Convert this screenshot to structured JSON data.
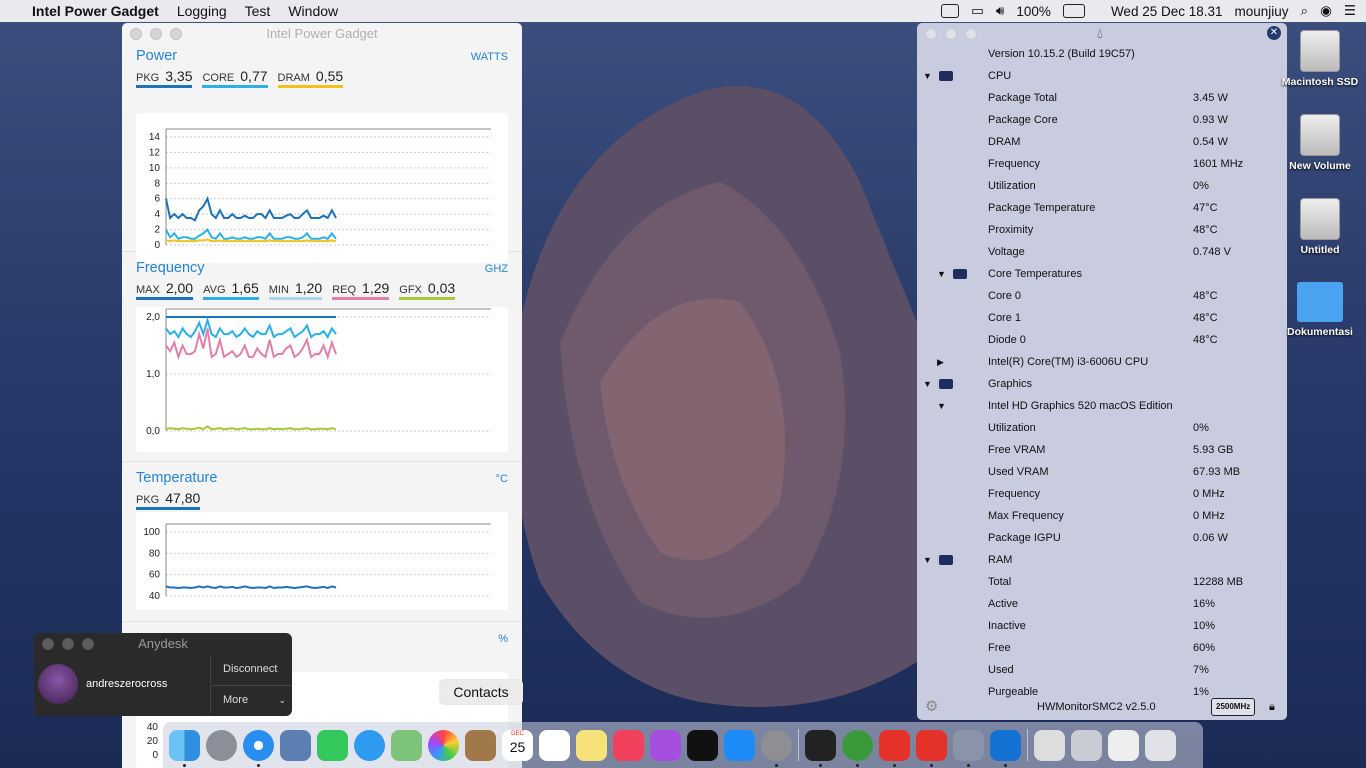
{
  "menubar": {
    "app": "Intel Power Gadget",
    "menus": [
      "Logging",
      "Test",
      "Window"
    ],
    "battery": "100%",
    "clock": "Wed 25 Dec  18.31",
    "user": "mounjiuy"
  },
  "ipg": {
    "title": "Intel Power Gadget",
    "power": {
      "label": "Power",
      "unit": "WATTS",
      "metrics": [
        {
          "k": "PKG",
          "v": "3,35",
          "color": "#1e72b8"
        },
        {
          "k": "CORE",
          "v": "0,77",
          "color": "#2ab0e4"
        },
        {
          "k": "DRAM",
          "v": "0,55",
          "color": "#f2c21b"
        }
      ],
      "yticks": [
        "14",
        "12",
        "10",
        "8",
        "6",
        "4",
        "2",
        "0"
      ]
    },
    "frequency": {
      "label": "Frequency",
      "unit": "GHZ",
      "metrics": [
        {
          "k": "MAX",
          "v": "2,00",
          "color": "#1e72b8"
        },
        {
          "k": "AVG",
          "v": "1,65",
          "color": "#2ab0e4"
        },
        {
          "k": "MIN",
          "v": "1,20",
          "color": "#a8d8f0"
        },
        {
          "k": "REQ",
          "v": "1,29",
          "color": "#e080a8"
        },
        {
          "k": "GFX",
          "v": "0,03",
          "color": "#a8c83c"
        }
      ],
      "yticks": [
        "2,0",
        "1,0",
        "0,0"
      ]
    },
    "temperature": {
      "label": "Temperature",
      "unit": "°C",
      "metrics": [
        {
          "k": "PKG",
          "v": "47,80",
          "color": "#1e72b8"
        }
      ],
      "yticks": [
        "100",
        "80",
        "60",
        "40"
      ]
    },
    "utilization": {
      "unit": "%",
      "yticks": [
        "40",
        "20",
        "0"
      ]
    }
  },
  "chart_data": [
    {
      "type": "line",
      "title": "Power",
      "ylabel": "WATTS",
      "ylim": [
        0,
        14
      ],
      "series": [
        {
          "name": "PKG",
          "values": [
            6,
            3.5,
            4,
            3.5,
            4,
            3.5,
            3.5,
            3.2,
            4.5,
            5,
            6,
            4,
            3.5,
            4.5,
            3.5,
            3.5,
            4,
            3.5,
            3.5,
            3.8,
            3.5,
            3.5,
            4,
            4,
            3.5,
            4.5,
            3.5,
            3.5,
            3.5,
            3.8,
            4,
            3.5,
            3.5,
            4,
            4.5,
            3.5,
            3.5,
            3.5,
            3.8,
            3.5,
            4.5,
            3.5
          ]
        },
        {
          "name": "CORE",
          "values": [
            2,
            1,
            1.5,
            0.8,
            1,
            1,
            0.8,
            0.8,
            1.2,
            1.5,
            2,
            1,
            0.8,
            1.5,
            0.8,
            0.8,
            1,
            0.8,
            0.8,
            1,
            0.8,
            0.8,
            1,
            1,
            0.8,
            1.5,
            0.8,
            0.8,
            0.8,
            1,
            1,
            0.8,
            0.8,
            1,
            1.5,
            0.8,
            0.8,
            0.8,
            1,
            0.8,
            1.5,
            0.8
          ]
        },
        {
          "name": "DRAM",
          "values": [
            0.6,
            0.5,
            0.6,
            0.5,
            0.5,
            0.5,
            0.5,
            0.5,
            0.6,
            0.6,
            0.7,
            0.5,
            0.5,
            0.6,
            0.5,
            0.5,
            0.5,
            0.5,
            0.5,
            0.5,
            0.5,
            0.5,
            0.5,
            0.5,
            0.5,
            0.6,
            0.5,
            0.5,
            0.5,
            0.5,
            0.5,
            0.5,
            0.5,
            0.5,
            0.6,
            0.5,
            0.5,
            0.5,
            0.5,
            0.5,
            0.6,
            0.5
          ]
        }
      ]
    },
    {
      "type": "line",
      "title": "Frequency",
      "ylabel": "GHZ",
      "ylim": [
        0,
        2
      ],
      "series": [
        {
          "name": "MAX",
          "values": [
            2,
            2,
            2,
            2,
            2,
            2,
            2,
            2,
            2,
            2,
            2,
            2,
            2,
            2,
            2,
            2,
            2,
            2,
            2,
            2,
            2,
            2,
            2,
            2,
            2,
            2,
            2,
            2,
            2,
            2,
            2,
            2,
            2,
            2,
            2,
            2,
            2,
            2,
            2,
            2,
            2,
            2
          ]
        },
        {
          "name": "AVG",
          "values": [
            1.8,
            1.7,
            1.75,
            1.65,
            1.8,
            1.7,
            1.65,
            1.75,
            1.9,
            1.7,
            1.95,
            1.7,
            1.65,
            1.8,
            1.7,
            1.7,
            1.75,
            1.65,
            1.7,
            1.8,
            1.7,
            1.65,
            1.75,
            1.7,
            1.7,
            1.85,
            1.65,
            1.7,
            1.7,
            1.75,
            1.8,
            1.65,
            1.7,
            1.75,
            1.85,
            1.65,
            1.7,
            1.7,
            1.75,
            1.65,
            1.8,
            1.7
          ]
        },
        {
          "name": "REQ",
          "values": [
            1.5,
            1.4,
            1.55,
            1.3,
            1.5,
            1.35,
            1.35,
            1.4,
            1.7,
            1.45,
            1.8,
            1.3,
            1.35,
            1.6,
            1.3,
            1.35,
            1.4,
            1.3,
            1.35,
            1.5,
            1.3,
            1.3,
            1.45,
            1.35,
            1.3,
            1.6,
            1.3,
            1.35,
            1.35,
            1.45,
            1.5,
            1.3,
            1.35,
            1.45,
            1.6,
            1.3,
            1.35,
            1.35,
            1.5,
            1.3,
            1.55,
            1.35
          ]
        },
        {
          "name": "GFX",
          "values": [
            0.03,
            0.05,
            0.04,
            0.03,
            0.05,
            0.04,
            0.03,
            0.04,
            0.06,
            0.03,
            0.08,
            0.03,
            0.04,
            0.05,
            0.03,
            0.04,
            0.05,
            0.03,
            0.04,
            0.05,
            0.03,
            0.03,
            0.04,
            0.03,
            0.03,
            0.05,
            0.03,
            0.04,
            0.03,
            0.04,
            0.05,
            0.03,
            0.03,
            0.04,
            0.05,
            0.03,
            0.03,
            0.04,
            0.04,
            0.03,
            0.05,
            0.03
          ]
        }
      ]
    },
    {
      "type": "line",
      "title": "Temperature",
      "ylabel": "°C",
      "ylim": [
        40,
        100
      ],
      "series": [
        {
          "name": "PKG",
          "values": [
            49,
            48,
            48,
            47.5,
            48,
            48,
            47.5,
            48,
            49,
            48,
            49,
            48,
            47.5,
            49,
            48,
            48,
            48.5,
            47.5,
            48,
            49,
            48,
            47.5,
            48,
            48,
            47.5,
            49,
            47.5,
            48,
            48,
            48.5,
            48,
            47.5,
            48,
            48.5,
            49,
            48,
            47.5,
            48,
            48.5,
            47.5,
            49,
            48
          ]
        }
      ]
    }
  ],
  "hwm": {
    "version": "Version 10.15.2 (Build 19C57)",
    "rows": [
      {
        "label": "CPU",
        "val": "",
        "tri": "down",
        "ico": true
      },
      {
        "label": "Package Total",
        "val": "3.45 W"
      },
      {
        "label": "Package Core",
        "val": "0.93 W"
      },
      {
        "label": "DRAM",
        "val": "0.54 W"
      },
      {
        "label": "Frequency",
        "val": "1601 MHz"
      },
      {
        "label": "Utilization",
        "val": "0%"
      },
      {
        "label": "Package Temperature",
        "val": "47°C"
      },
      {
        "label": "Proximity",
        "val": "48°C"
      },
      {
        "label": "Voltage",
        "val": "0.748 V"
      },
      {
        "label": "Core Temperatures",
        "val": "",
        "tri": "down2",
        "ico2": true
      },
      {
        "label": "Core 0",
        "val": "48°C"
      },
      {
        "label": "Core 1",
        "val": "48°C"
      },
      {
        "label": "Diode 0",
        "val": "48°C"
      },
      {
        "label": "Intel(R) Core(TM) i3-6006U CPU",
        "val": "",
        "tri": "right2"
      },
      {
        "label": "Graphics",
        "val": "",
        "tri": "down",
        "ico": true
      },
      {
        "label": "Intel HD Graphics 520 macOS Edition",
        "val": "",
        "tri": "down2"
      },
      {
        "label": "Utilization",
        "val": "0%"
      },
      {
        "label": "Free VRAM",
        "val": "5.93 GB"
      },
      {
        "label": "Used VRAM",
        "val": "67.93 MB"
      },
      {
        "label": "Frequency",
        "val": "0 MHz"
      },
      {
        "label": "Max Frequency",
        "val": "0 MHz"
      },
      {
        "label": "Package IGPU",
        "val": "0.06 W"
      },
      {
        "label": "RAM",
        "val": "",
        "tri": "down",
        "ico": true
      },
      {
        "label": "Total",
        "val": "12288 MB"
      },
      {
        "label": "Active",
        "val": "16%"
      },
      {
        "label": "Inactive",
        "val": "10%"
      },
      {
        "label": "Free",
        "val": "60%"
      },
      {
        "label": "Used",
        "val": "7%"
      },
      {
        "label": "Purgeable",
        "val": "1%"
      }
    ],
    "footer": "HWMonitorSMC2 v2.5.0",
    "badge": "2500MHz"
  },
  "desktop": {
    "icons": [
      "Macintosh SSD",
      "New Volume",
      "Untitled",
      "Dokumentasi"
    ]
  },
  "anydesk": {
    "title": "Anydesk",
    "user": "andreszerocross",
    "disconnect": "Disconnect",
    "more": "More"
  },
  "tooltip": "Contacts",
  "dock": {
    "date": "25"
  }
}
